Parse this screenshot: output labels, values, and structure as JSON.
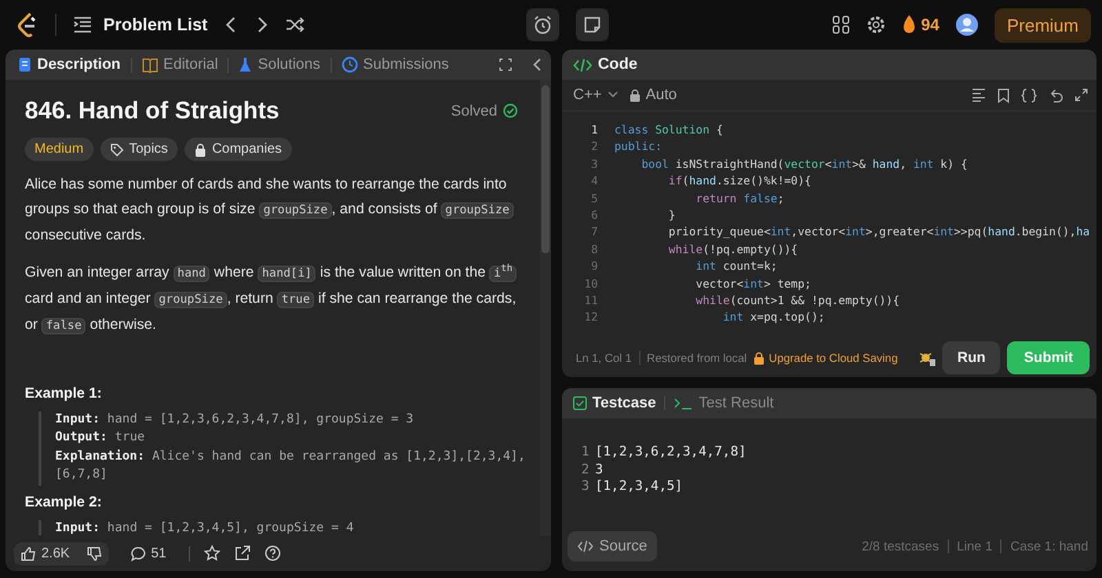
{
  "topbar": {
    "title": "Problem List",
    "streak": "94",
    "premium": "Premium"
  },
  "description": {
    "tabs": [
      {
        "label": "Description",
        "selected": true
      },
      {
        "label": "Editorial",
        "selected": false
      },
      {
        "label": "Solutions",
        "selected": false
      },
      {
        "label": "Submissions",
        "selected": false
      }
    ],
    "title": "846. Hand of Straights",
    "status": "Solved",
    "difficulty": "Medium",
    "tags": [
      "Topics",
      "Companies"
    ],
    "paragraphs": [
      [
        {
          "text": "Alice has some number of cards and she wants to rearrange the cards into groups so that each group is of size ",
          "code": false
        },
        {
          "text": "groupSize",
          "code": true
        },
        {
          "text": ", and consists of ",
          "code": false
        },
        {
          "text": "groupSize",
          "code": true
        },
        {
          "text": " consecutive cards.",
          "code": false
        }
      ],
      [
        {
          "text": "Given an integer array ",
          "code": false
        },
        {
          "text": "hand",
          "code": true
        },
        {
          "text": " where ",
          "code": false
        },
        {
          "text": "hand[i]",
          "code": true
        },
        {
          "text": " is the value written on the ",
          "code": false
        },
        {
          "text": "i$^{th}$",
          "code": true
        },
        {
          "text": " card and an integer ",
          "code": false
        },
        {
          "text": "groupSize",
          "code": true
        },
        {
          "text": ", return ",
          "code": false
        },
        {
          "text": "true",
          "code": true
        },
        {
          "text": " if she can rearrange the cards, or ",
          "code": false
        },
        {
          "text": "false",
          "code": true
        },
        {
          "text": " otherwise.",
          "code": false
        }
      ]
    ],
    "examples": [
      {
        "heading": "Example 1:",
        "lines": [
          {
            "label": "Input:",
            "value": "hand = [1,2,3,6,2,3,4,7,8], groupSize = 3"
          },
          {
            "label": "Output:",
            "value": "true"
          },
          {
            "label": "Explanation:",
            "value": "Alice's hand can be rearranged as [1,2,3],[2,3,4],[6,7,8]"
          }
        ]
      },
      {
        "heading": "Example 2:",
        "lines": [
          {
            "label": "Input:",
            "value": "hand = [1,2,3,4,5], groupSize = 4"
          }
        ]
      }
    ],
    "likes": "2.6K",
    "comments": "51"
  },
  "editor": {
    "title": "Code",
    "language": "C++",
    "mode": "Auto",
    "lines": [
      {
        "number": "1",
        "active": true,
        "tokens": [
          {
            "kind": "kw",
            "text": "class "
          },
          {
            "kind": "type",
            "text": "Solution"
          },
          {
            "kind": "p",
            "text": " {"
          }
        ]
      },
      {
        "number": "2",
        "active": false,
        "tokens": [
          {
            "kind": "kw",
            "text": "public:"
          }
        ]
      },
      {
        "number": "3",
        "active": false,
        "tokens": [
          {
            "kind": "kw",
            "text": "    bool"
          },
          {
            "kind": "p",
            "text": " isNStraightHand("
          },
          {
            "kind": "type",
            "text": "vector"
          },
          {
            "kind": "p",
            "text": "<"
          },
          {
            "kind": "kw",
            "text": "int"
          },
          {
            "kind": "p",
            "text": ">& "
          },
          {
            "kind": "var",
            "text": "hand"
          },
          {
            "kind": "p",
            "text": ", "
          },
          {
            "kind": "kw",
            "text": "int"
          },
          {
            "kind": "p",
            "text": " k) {"
          }
        ]
      },
      {
        "number": "4",
        "active": false,
        "tokens": [
          {
            "kind": "ctrl",
            "text": "        if"
          },
          {
            "kind": "p",
            "text": "("
          },
          {
            "kind": "var",
            "text": "hand"
          },
          {
            "kind": "p",
            "text": ".size()%k!=0){"
          }
        ]
      },
      {
        "number": "5",
        "active": false,
        "tokens": [
          {
            "kind": "ctrl",
            "text": "            return "
          },
          {
            "kind": "kw",
            "text": "false"
          },
          {
            "kind": "p",
            "text": ";"
          }
        ]
      },
      {
        "number": "6",
        "active": false,
        "tokens": [
          {
            "kind": "p",
            "text": "        }"
          }
        ]
      },
      {
        "number": "7",
        "active": false,
        "tokens": [
          {
            "kind": "p",
            "text": "        priority_queue<"
          },
          {
            "kind": "kw",
            "text": "int"
          },
          {
            "kind": "p",
            "text": ",vector<"
          },
          {
            "kind": "kw",
            "text": "int"
          },
          {
            "kind": "p",
            "text": ">,greater<"
          },
          {
            "kind": "kw",
            "text": "int"
          },
          {
            "kind": "p",
            "text": ">>pq("
          },
          {
            "kind": "var",
            "text": "hand"
          },
          {
            "kind": "p",
            "text": ".begin(),"
          },
          {
            "kind": "var",
            "text": "ha"
          }
        ]
      },
      {
        "number": "8",
        "active": false,
        "tokens": [
          {
            "kind": "ctrl",
            "text": "        while"
          },
          {
            "kind": "p",
            "text": "(!pq.empty()){"
          }
        ]
      },
      {
        "number": "9",
        "active": false,
        "tokens": [
          {
            "kind": "kw",
            "text": "            int"
          },
          {
            "kind": "p",
            "text": " count=k;"
          }
        ]
      },
      {
        "number": "10",
        "active": false,
        "tokens": [
          {
            "kind": "p",
            "text": "            vector<"
          },
          {
            "kind": "kw",
            "text": "int"
          },
          {
            "kind": "p",
            "text": "> temp;"
          }
        ]
      },
      {
        "number": "11",
        "active": false,
        "tokens": [
          {
            "kind": "ctrl",
            "text": "            while"
          },
          {
            "kind": "p",
            "text": "(count>1 && !pq.empty()){"
          }
        ]
      },
      {
        "number": "12",
        "active": false,
        "tokens": [
          {
            "kind": "kw",
            "text": "                int"
          },
          {
            "kind": "p",
            "text": " x=pq.top();"
          }
        ]
      }
    ],
    "cursor": "Ln 1, Col 1",
    "save_status": "Restored from local",
    "upgrade": "Upgrade to Cloud Saving",
    "run": "Run",
    "submit": "Submit"
  },
  "testcase": {
    "tabs": [
      {
        "label": "Testcase",
        "selected": true
      },
      {
        "label": "Test Result",
        "selected": false
      }
    ],
    "lines": [
      {
        "number": "1",
        "text": "[1,2,3,6,2,3,4,7,8]"
      },
      {
        "number": "2",
        "text": "3"
      },
      {
        "number": "3",
        "text": "[1,2,3,4,5]"
      }
    ],
    "source": "Source",
    "status": [
      "2/8 testcases",
      "Line 1",
      "Case 1: hand"
    ]
  }
}
